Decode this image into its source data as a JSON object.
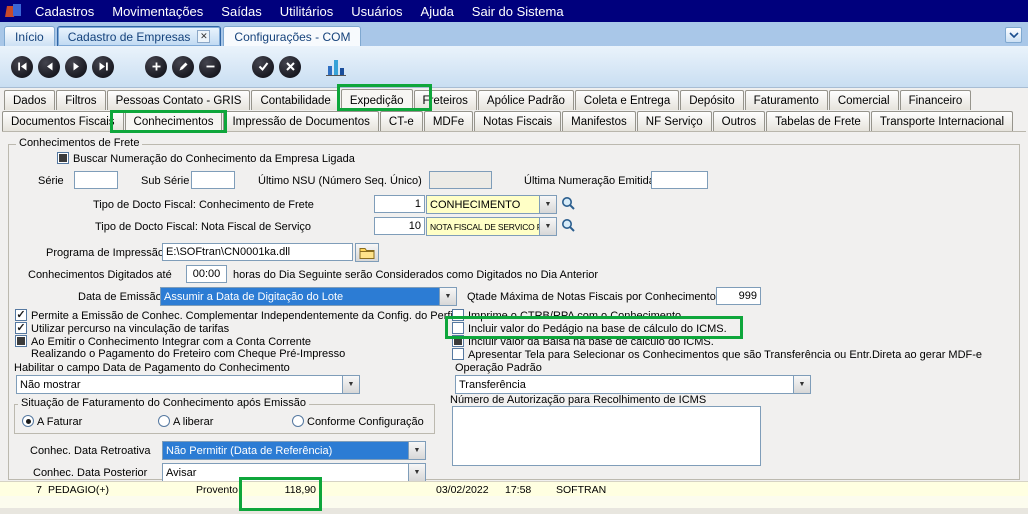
{
  "colors": {
    "menubar_blue": "#00007D",
    "annotation_green": "#0EA63B",
    "selection_blue": "#2C7CD4",
    "combo_yellow": "#FFFFC6",
    "grid_yellow": "#FFFFE1"
  },
  "menubar": {
    "items": [
      "Cadastros",
      "Movimentações",
      "Saídas",
      "Utilitários",
      "Usuários",
      "Ajuda",
      "Sair do Sistema"
    ]
  },
  "window_tabs": {
    "items": [
      "Início",
      "Cadastro de Empresas",
      "Configurações - COM"
    ],
    "active": "Configurações - COM",
    "close_glyph": "✕",
    "chevron_glyph": "⌄"
  },
  "toolbar": {
    "buttons": [
      "first-record",
      "previous-record",
      "next-record",
      "last-record",
      "add",
      "edit",
      "delete",
      "confirm",
      "cancel",
      "chart"
    ]
  },
  "tabstrip_main": {
    "tabs": [
      "Dados",
      "Filtros",
      "Pessoas Contato - GRIS",
      "Contabilidade",
      "Expedição",
      "Freteiros",
      "Apólice Padrão",
      "Coleta e Entrega",
      "Depósito",
      "Faturamento",
      "Comercial",
      "Financeiro"
    ],
    "active": "Expedição"
  },
  "tabstrip_sub": {
    "tabs": [
      "Documentos Fiscais",
      "Conhecimentos",
      "Impressão de Documentos",
      "CT-e",
      "MDFe",
      "Notas Fiscais",
      "Manifestos",
      "NF Serviço",
      "Outros",
      "Tabelas de Frete",
      "Transporte Internacional"
    ],
    "active": "Conhecimentos"
  },
  "form": {
    "group_title": "Conhecimentos de Frete",
    "chk_buscar": "Buscar Numeração do Conhecimento da Empresa Ligada",
    "serie_label": "Série",
    "serie_value": "",
    "subserie_label": "Sub Série",
    "subserie_value": "",
    "nsu_label": "Último NSU (Número Seq. Único)",
    "nsu_value": "",
    "ultima_label": "Última Numeração Emitida",
    "ultima_value": "",
    "tipo_frete_label": "Tipo de Docto Fiscal: Conhecimento de Frete",
    "tipo_frete_code": "1",
    "tipo_frete_value": "CONHECIMENTO",
    "tipo_servico_label": "Tipo de Docto Fiscal: Nota Fiscal de Serviço",
    "tipo_servico_code": "10",
    "tipo_servico_value": "NOTA FISCAL DE SERVICO RIO DE JANE",
    "programa_label": "Programa de Impressão",
    "programa_value": "E:\\SOFtran\\CN0001ka.dll",
    "digitados_label": "Conhecimentos Digitados até",
    "digitados_value": "00:00",
    "digitados_suffix": "horas do Dia Seguinte serão Considerados como Digitados no Dia Anterior",
    "data_emissao_label": "Data de Emissão",
    "data_emissao_value": "Assumir a Data de Digitação do Lote",
    "qtade_label": "Qtade Máxima de Notas Fiscais por Conhecimento",
    "qtade_value": "999",
    "chk_permite": "Permite a Emissão de Conhec. Complementar Independentemente da Config. do Perfil",
    "chk_percurso": "Utilizar percurso na vinculação de tarifas",
    "chk_conta_corrente": "Ao Emitir o Conhecimento Integrar com a Conta Corrente",
    "chk_conta_corrente_line2": "Realizando o Pagamento do Freteiro com Cheque Pré-Impresso",
    "chk_imprime": "Imprime o CTRB/RPA com o Conhecimento",
    "chk_pedagio": "Incluir valor do Pedágio na base de cálculo do ICMS.",
    "chk_balsa": "Incluir valor da Balsa na base de cálculo do ICMS.",
    "chk_apresentar": "Apresentar Tela para Selecionar os Conhecimentos que são Transferência ou Entr.Direta ao gerar MDF-e",
    "habilitar_label": "Habilitar o campo Data de Pagamento do Conhecimento",
    "habilitar_value": "Não mostrar",
    "operacao_label": "Operação Padrão",
    "operacao_value": "Transferência",
    "situacao_title": "Situação de Faturamento do Conhecimento após Emissão",
    "radio_a_faturar": "A Faturar",
    "radio_a_liberar": "A liberar",
    "radio_conforme": "Conforme Configuração",
    "autorizacao_label": "Número de Autorização para Recolhimento de ICMS",
    "autorizacao_value": "",
    "retroativa_label": "Conhec. Data Retroativa",
    "retroativa_value": "Não Permitir (Data de Referência)",
    "posterior_label": "Conhec. Data Posterior",
    "posterior_value": "Avisar"
  },
  "states": {
    "buscar_filled": true,
    "permite_checked": true,
    "percurso_checked": true,
    "conta_filled": true,
    "imprime_checked": false,
    "pedagio_checked": false,
    "balsa_filled": true,
    "apresentar_checked": false,
    "a_faturar_selected": true,
    "a_liberar_selected": false,
    "conforme_selected": false
  },
  "grid_row": {
    "code": "7",
    "name": "PEDAGIO(+)",
    "type": "Provento",
    "value": "118,90",
    "date": "03/02/2022",
    "time": "17:58",
    "user": "SOFTRAN"
  }
}
